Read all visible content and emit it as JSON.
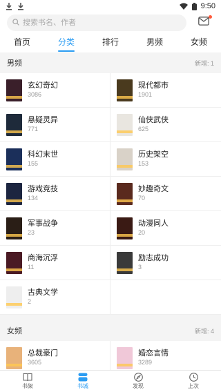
{
  "status_bar": {
    "time": "9:50"
  },
  "search": {
    "placeholder": "搜索书名、作者"
  },
  "tabs": [
    {
      "label": "首页",
      "active": false
    },
    {
      "label": "分类",
      "active": true
    },
    {
      "label": "排行",
      "active": false
    },
    {
      "label": "男频",
      "active": false
    },
    {
      "label": "女频",
      "active": false
    }
  ],
  "sections": {
    "male": {
      "title": "男频",
      "note": "新增: 1",
      "categories": [
        {
          "name": "玄幻奇幻",
          "count": "3086",
          "cover_color": "#3a1f2a"
        },
        {
          "name": "现代都市",
          "count": "1901",
          "cover_color": "#4a3a1e"
        },
        {
          "name": "悬疑灵异",
          "count": "771",
          "cover_color": "#1e2a3a"
        },
        {
          "name": "仙侠武侠",
          "count": "625",
          "cover_color": "#e9e6e0"
        },
        {
          "name": "科幻末世",
          "count": "155",
          "cover_color": "#1b2f5a"
        },
        {
          "name": "历史架空",
          "count": "153",
          "cover_color": "#d9d2c8"
        },
        {
          "name": "游戏竞技",
          "count": "134",
          "cover_color": "#1c2540"
        },
        {
          "name": "妙趣奇文",
          "count": "70",
          "cover_color": "#5a2a1e"
        },
        {
          "name": "军事战争",
          "count": "23",
          "cover_color": "#2a1e16"
        },
        {
          "name": "动漫同人",
          "count": "20",
          "cover_color": "#3a1a14"
        },
        {
          "name": "商海沉浮",
          "count": "11",
          "cover_color": "#4a1a24"
        },
        {
          "name": "励志成功",
          "count": "3",
          "cover_color": "#3a3a3a"
        },
        {
          "name": "古典文学",
          "count": "2",
          "cover_color": "#eeeeee"
        }
      ]
    },
    "female": {
      "title": "女频",
      "note": "新增: 4",
      "categories": [
        {
          "name": "总裁豪门",
          "count": "3605",
          "cover_color": "#e8b27a"
        },
        {
          "name": "婚恋言情",
          "count": "3289",
          "cover_color": "#f0c8d8"
        }
      ]
    }
  },
  "bottom_nav": [
    {
      "label": "书架",
      "icon": "book-icon",
      "active": false
    },
    {
      "label": "书城",
      "icon": "store-icon",
      "active": true
    },
    {
      "label": "发现",
      "icon": "compass-icon",
      "active": false
    },
    {
      "label": "上次",
      "icon": "clock-icon",
      "active": false
    }
  ],
  "colors": {
    "accent": "#2b9cf2",
    "badge": "#ff5a3c"
  }
}
